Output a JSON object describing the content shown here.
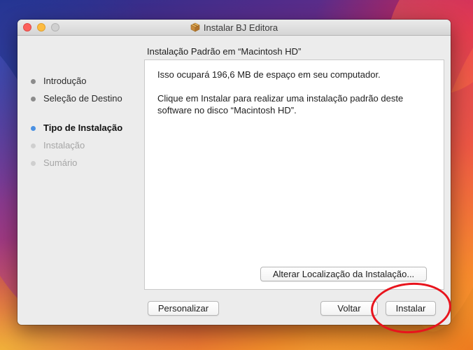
{
  "window": {
    "title": "Instalar BJ Editora",
    "title_icon": "package-icon"
  },
  "sidebar": {
    "items": [
      {
        "label": "Introdução",
        "state": "done"
      },
      {
        "label": "Seleção de Destino",
        "state": "done"
      },
      {
        "label": "Tipo de Instalação",
        "state": "current"
      },
      {
        "label": "Instalação",
        "state": "pending"
      },
      {
        "label": "Sumário",
        "state": "pending"
      }
    ]
  },
  "main": {
    "heading": "Instalação Padrão em “Macintosh HD”",
    "paragraph_1": "Isso ocupará 196,6 MB de espaço em seu computador.",
    "paragraph_2": "Clique em Instalar para realizar uma instalação padrão deste software no disco “Macintosh HD”.",
    "change_location_label": "Alterar Localização da Instalação..."
  },
  "buttons": {
    "customize_label": "Personalizar",
    "back_label": "Voltar",
    "install_label": "Instalar"
  },
  "colors": {
    "current_step_dot": "#4a90e2",
    "annotation_circle": "#e8141d",
    "close_button": "#fc605c",
    "minimize_button": "#fdbc40"
  }
}
